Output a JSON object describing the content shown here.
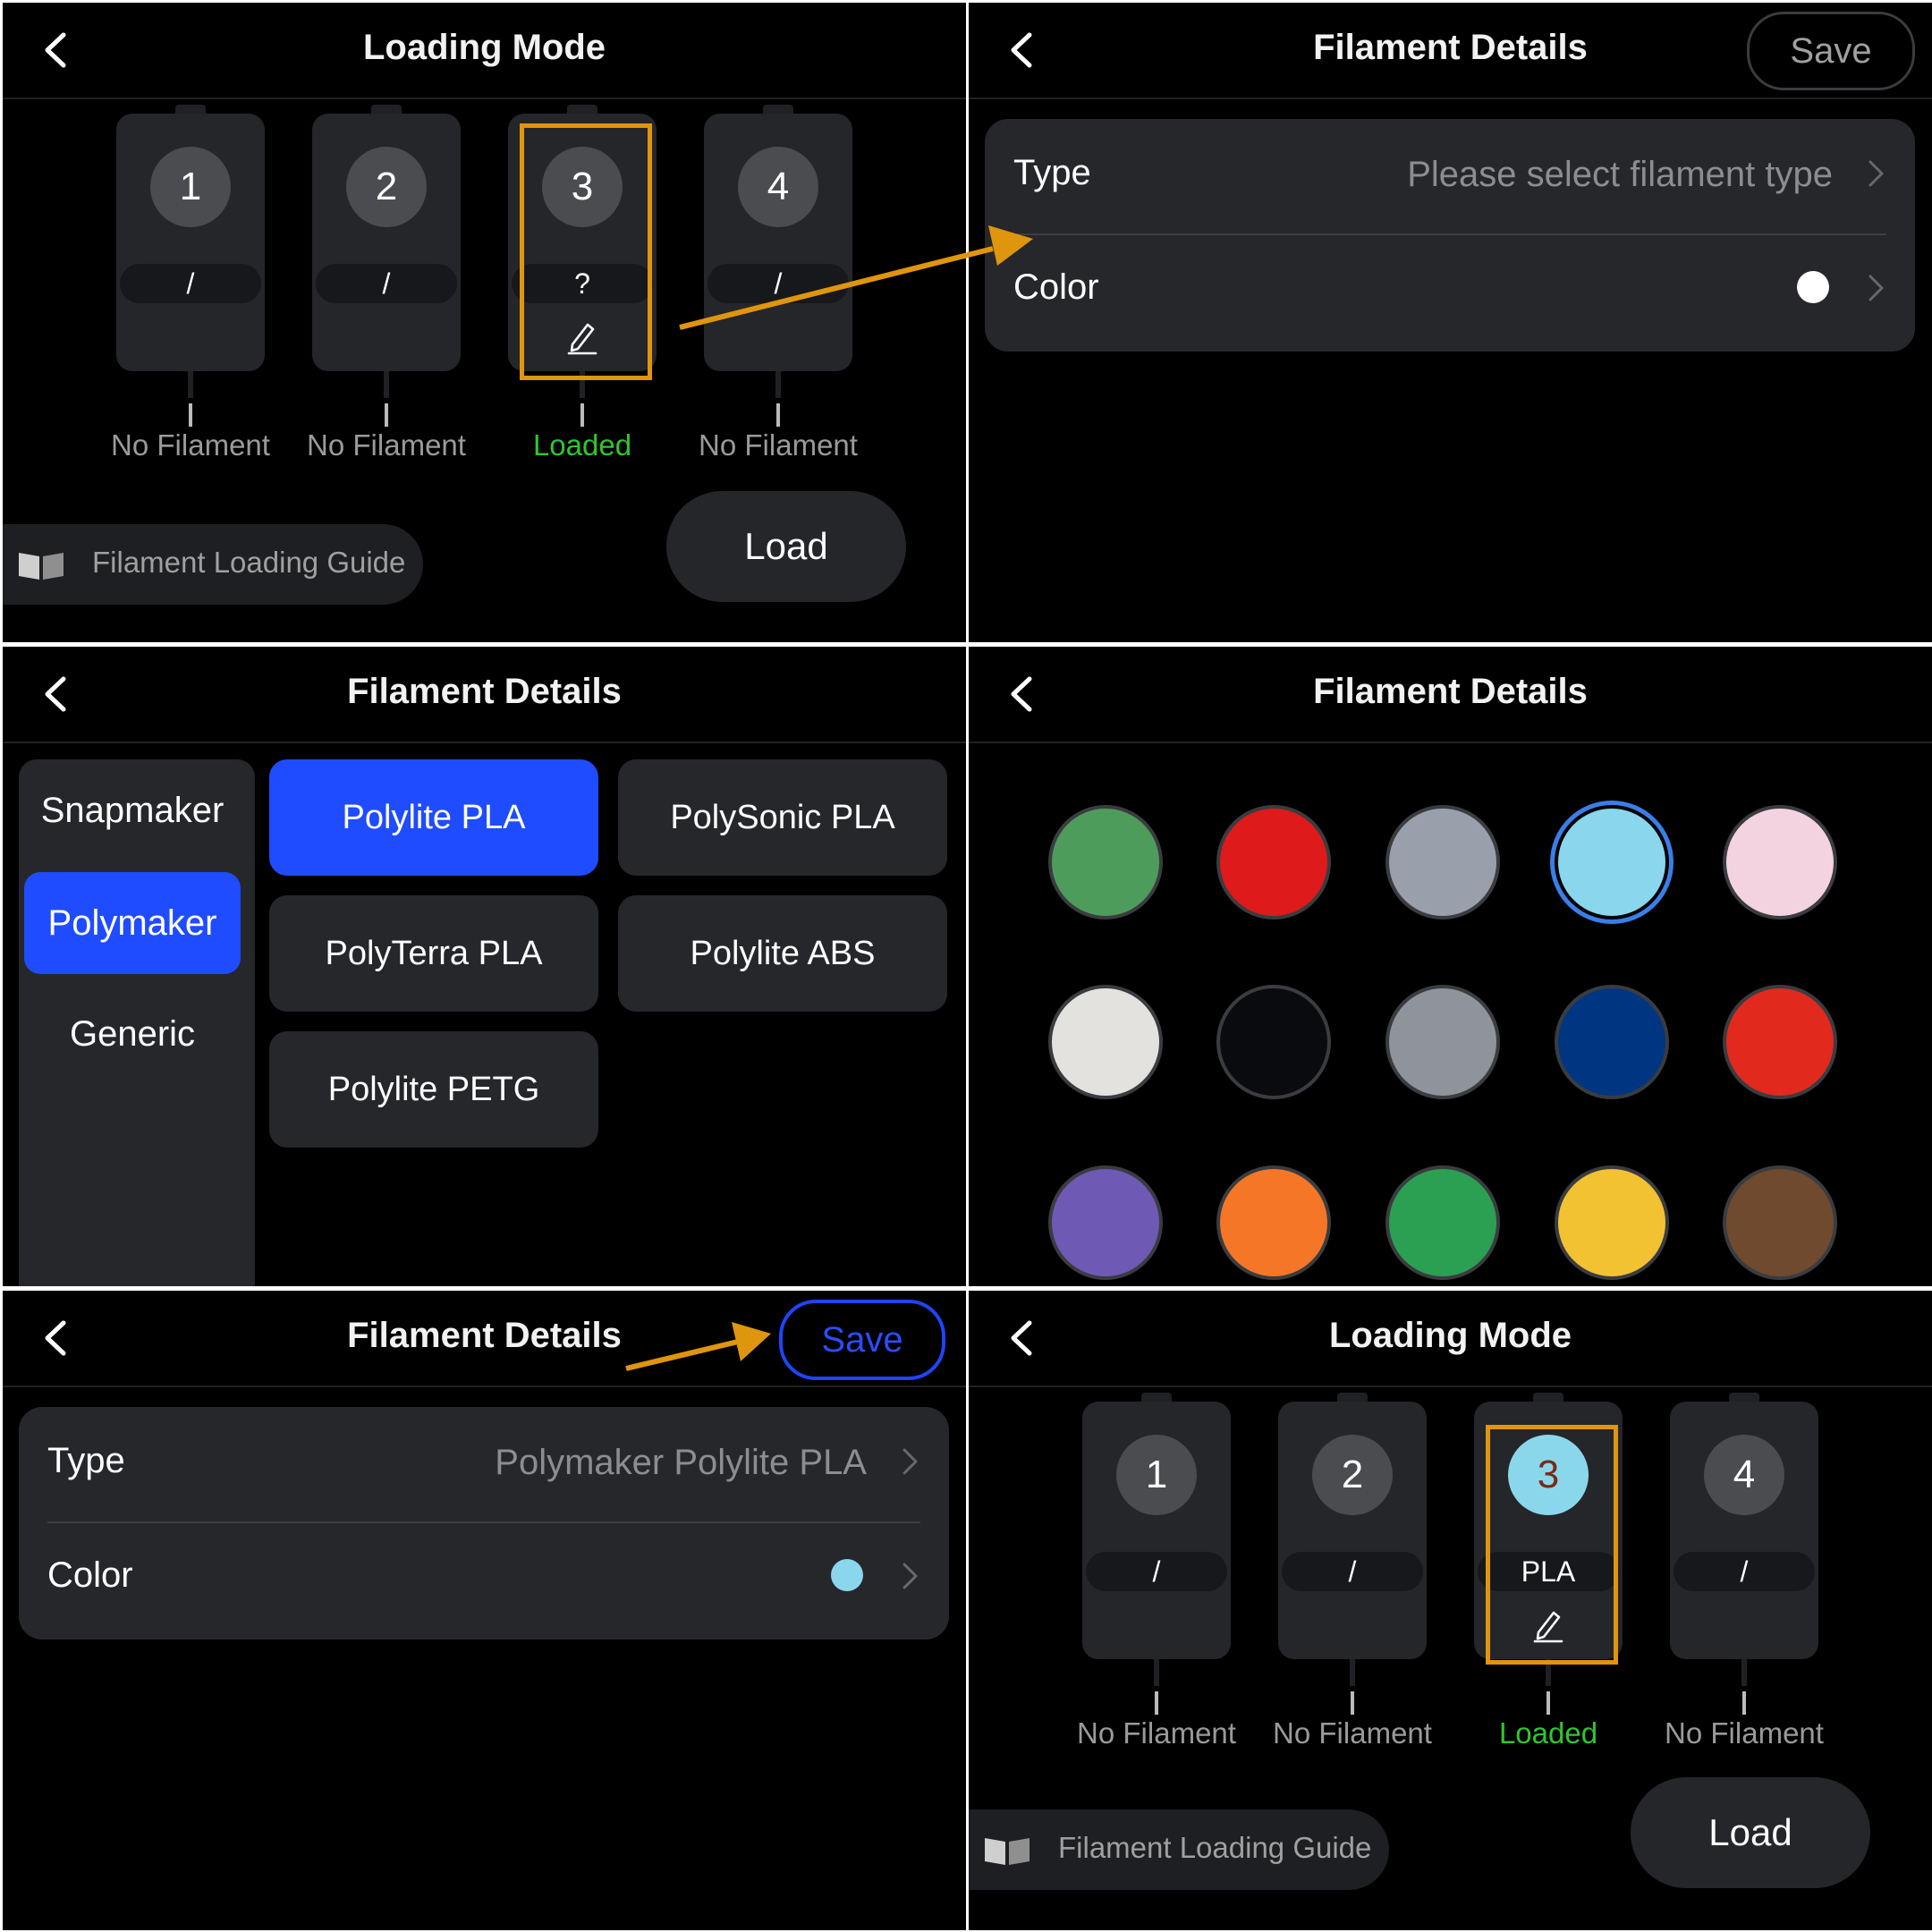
{
  "panels": {
    "loading_mode_1": {
      "title": "Loading Mode",
      "slots": [
        {
          "number": "1",
          "material": "/",
          "status": "No Filament"
        },
        {
          "number": "2",
          "material": "/",
          "status": "No Filament"
        },
        {
          "number": "3",
          "material": "?",
          "status": "Loaded"
        },
        {
          "number": "4",
          "material": "/",
          "status": "No Filament"
        }
      ],
      "guide_label": "Filament Loading Guide",
      "load_label": "Load"
    },
    "details_empty": {
      "title": "Filament Details",
      "save_label": "Save",
      "type_label": "Type",
      "type_value": "Please select filament type",
      "color_label": "Color",
      "color_value": "#ffffff"
    },
    "type_select": {
      "title": "Filament Details",
      "brands": [
        "Snapmaker",
        "Polymaker",
        "Generic"
      ],
      "selected_brand": "Polymaker",
      "types": [
        "Polylite PLA",
        "PolySonic PLA",
        "PolyTerra PLA",
        "Polylite ABS",
        "Polylite PETG"
      ],
      "selected_type": "Polylite PLA"
    },
    "color_select": {
      "title": "Filament Details",
      "colors": [
        "#4e9c5c",
        "#de1a1a",
        "#9aa0ab",
        "#8ad6ec",
        "#f4d3e0",
        "#e4e2df",
        "#0a0b0f",
        "#8f949c",
        "#003681",
        "#e1291e",
        "#6e5ab5",
        "#f57627",
        "#2ba053",
        "#f3c233",
        "#704a2e"
      ],
      "selected_color": "#8ad6ec"
    },
    "details_filled": {
      "title": "Filament Details",
      "save_label": "Save",
      "type_label": "Type",
      "type_value": "Polymaker Polylite PLA",
      "color_label": "Color",
      "color_value": "#8ad6ec"
    },
    "loading_mode_2": {
      "title": "Loading Mode",
      "slots": [
        {
          "number": "1",
          "material": "/",
          "status": "No Filament"
        },
        {
          "number": "2",
          "material": "/",
          "status": "No Filament"
        },
        {
          "number": "3",
          "material": "PLA",
          "status": "Loaded"
        },
        {
          "number": "4",
          "material": "/",
          "status": "No Filament"
        }
      ],
      "guide_label": "Filament Loading Guide",
      "load_label": "Load"
    }
  },
  "colors": {
    "highlight": "#e0950e",
    "accent_blue": "#1f4cff",
    "loaded_green": "#2ec72e"
  }
}
